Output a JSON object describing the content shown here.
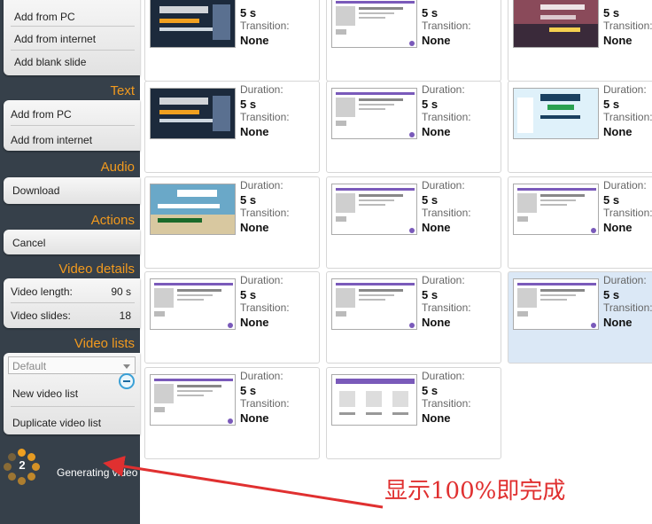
{
  "sidebar": {
    "images_items": [
      "Add from PC",
      "Add from internet",
      "Add blank slide"
    ],
    "text_section": "Text",
    "text_items": [
      "Add from PC",
      "Add from internet"
    ],
    "audio_section": "Audio",
    "audio_items": [
      "Download"
    ],
    "actions_section": "Actions",
    "actions_items": [
      "Cancel"
    ],
    "video_details_section": "Video details",
    "video_length_label": "Video length:",
    "video_length_value": "90 s",
    "video_slides_label": "Video slides:",
    "video_slides_value": "18",
    "video_lists_section": "Video lists",
    "video_list_select": "Default",
    "new_video_list": "New video list",
    "duplicate_video_list": "Duplicate video list",
    "progress_count": "2",
    "generating_label": "Generating video"
  },
  "slides": [
    {
      "duration_label": "",
      "duration": "5 s",
      "transition_label": "Transition:",
      "transition": "None",
      "thumb": "banner-dark"
    },
    {
      "duration_label": "",
      "duration": "5 s",
      "transition_label": "Transition:",
      "transition": "None",
      "thumb": "product-page"
    },
    {
      "duration_label": "",
      "duration": "5 s",
      "transition_label": "Transition:",
      "transition": "None",
      "thumb": "banner-sunset"
    },
    {
      "duration_label": "Duration:",
      "duration": "5 s",
      "transition_label": "Transition:",
      "transition": "None",
      "thumb": "banner-dark"
    },
    {
      "duration_label": "Duration:",
      "duration": "5 s",
      "transition_label": "Transition:",
      "transition": "None",
      "thumb": "product-page"
    },
    {
      "duration_label": "Duration:",
      "duration": "5 s",
      "transition_label": "Transition:",
      "transition": "None",
      "thumb": "banner-light"
    },
    {
      "duration_label": "Duration:",
      "duration": "5 s",
      "transition_label": "Transition:",
      "transition": "None",
      "thumb": "banner-ocean"
    },
    {
      "duration_label": "Duration:",
      "duration": "5 s",
      "transition_label": "Transition:",
      "transition": "None",
      "thumb": "product-page"
    },
    {
      "duration_label": "Duration:",
      "duration": "5 s",
      "transition_label": "Transition:",
      "transition": "None",
      "thumb": "product-page"
    },
    {
      "duration_label": "Duration:",
      "duration": "5 s",
      "transition_label": "Transition:",
      "transition": "None",
      "thumb": "product-page"
    },
    {
      "duration_label": "Duration:",
      "duration": "5 s",
      "transition_label": "Transition:",
      "transition": "None",
      "thumb": "product-page"
    },
    {
      "duration_label": "Duration:",
      "duration": "5 s",
      "transition_label": "Transition:",
      "transition": "None",
      "thumb": "product-page",
      "selected": true
    },
    {
      "duration_label": "Duration:",
      "duration": "5 s",
      "transition_label": "Transition:",
      "transition": "None",
      "thumb": "product-page"
    },
    {
      "duration_label": "Duration:",
      "duration": "5 s",
      "transition_label": "Transition:",
      "transition": "None",
      "thumb": "product-grid"
    }
  ],
  "annotation": {
    "text": "显示100%即完成",
    "color": "#e03030"
  },
  "colors": {
    "sidebar_bg": "#36404a",
    "section_header": "#f29a1e",
    "spinner": "#f0a020"
  }
}
